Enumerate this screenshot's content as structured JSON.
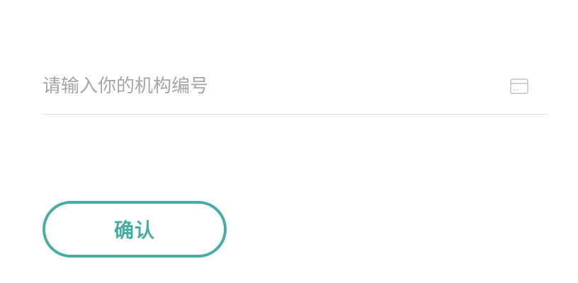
{
  "form": {
    "institution_code": {
      "value": "",
      "placeholder": "请输入你的机构编号",
      "icon": "card-icon"
    },
    "confirm_label": "确认"
  },
  "colors": {
    "accent": "#45ada3",
    "placeholder": "#a6a6a6",
    "divider": "#e3e3e3",
    "icon": "#c4c4c4"
  }
}
